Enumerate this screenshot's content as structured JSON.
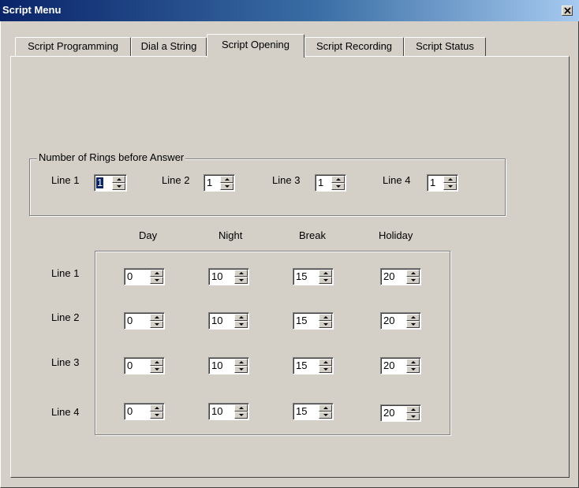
{
  "window": {
    "title": "Script Menu"
  },
  "tabs": [
    {
      "label": "Script Programming"
    },
    {
      "label": "Dial a String"
    },
    {
      "label": "Script Opening"
    },
    {
      "label": "Script Recording"
    },
    {
      "label": "Script Status"
    }
  ],
  "active_tab": "Script Opening",
  "rings_group": {
    "title": "Number of Rings before Answer",
    "lines": [
      {
        "label": "Line 1",
        "value": "1"
      },
      {
        "label": "Line 2",
        "value": "1"
      },
      {
        "label": "Line 3",
        "value": "1"
      },
      {
        "label": "Line 4",
        "value": "1"
      }
    ]
  },
  "schedule": {
    "columns": [
      "Day",
      "Night",
      "Break",
      "Holiday"
    ],
    "rows": [
      {
        "label": "Line 1",
        "values": [
          "0",
          "10",
          "15",
          "20"
        ]
      },
      {
        "label": "Line 2",
        "values": [
          "0",
          "10",
          "15",
          "20"
        ]
      },
      {
        "label": "Line 3",
        "values": [
          "0",
          "10",
          "15",
          "20"
        ]
      },
      {
        "label": "Line 4",
        "values": [
          "0",
          "10",
          "15",
          "20"
        ]
      }
    ]
  },
  "icons": {
    "close": "close-icon",
    "spin_up": "up-arrow-icon",
    "spin_down": "down-arrow-icon"
  }
}
